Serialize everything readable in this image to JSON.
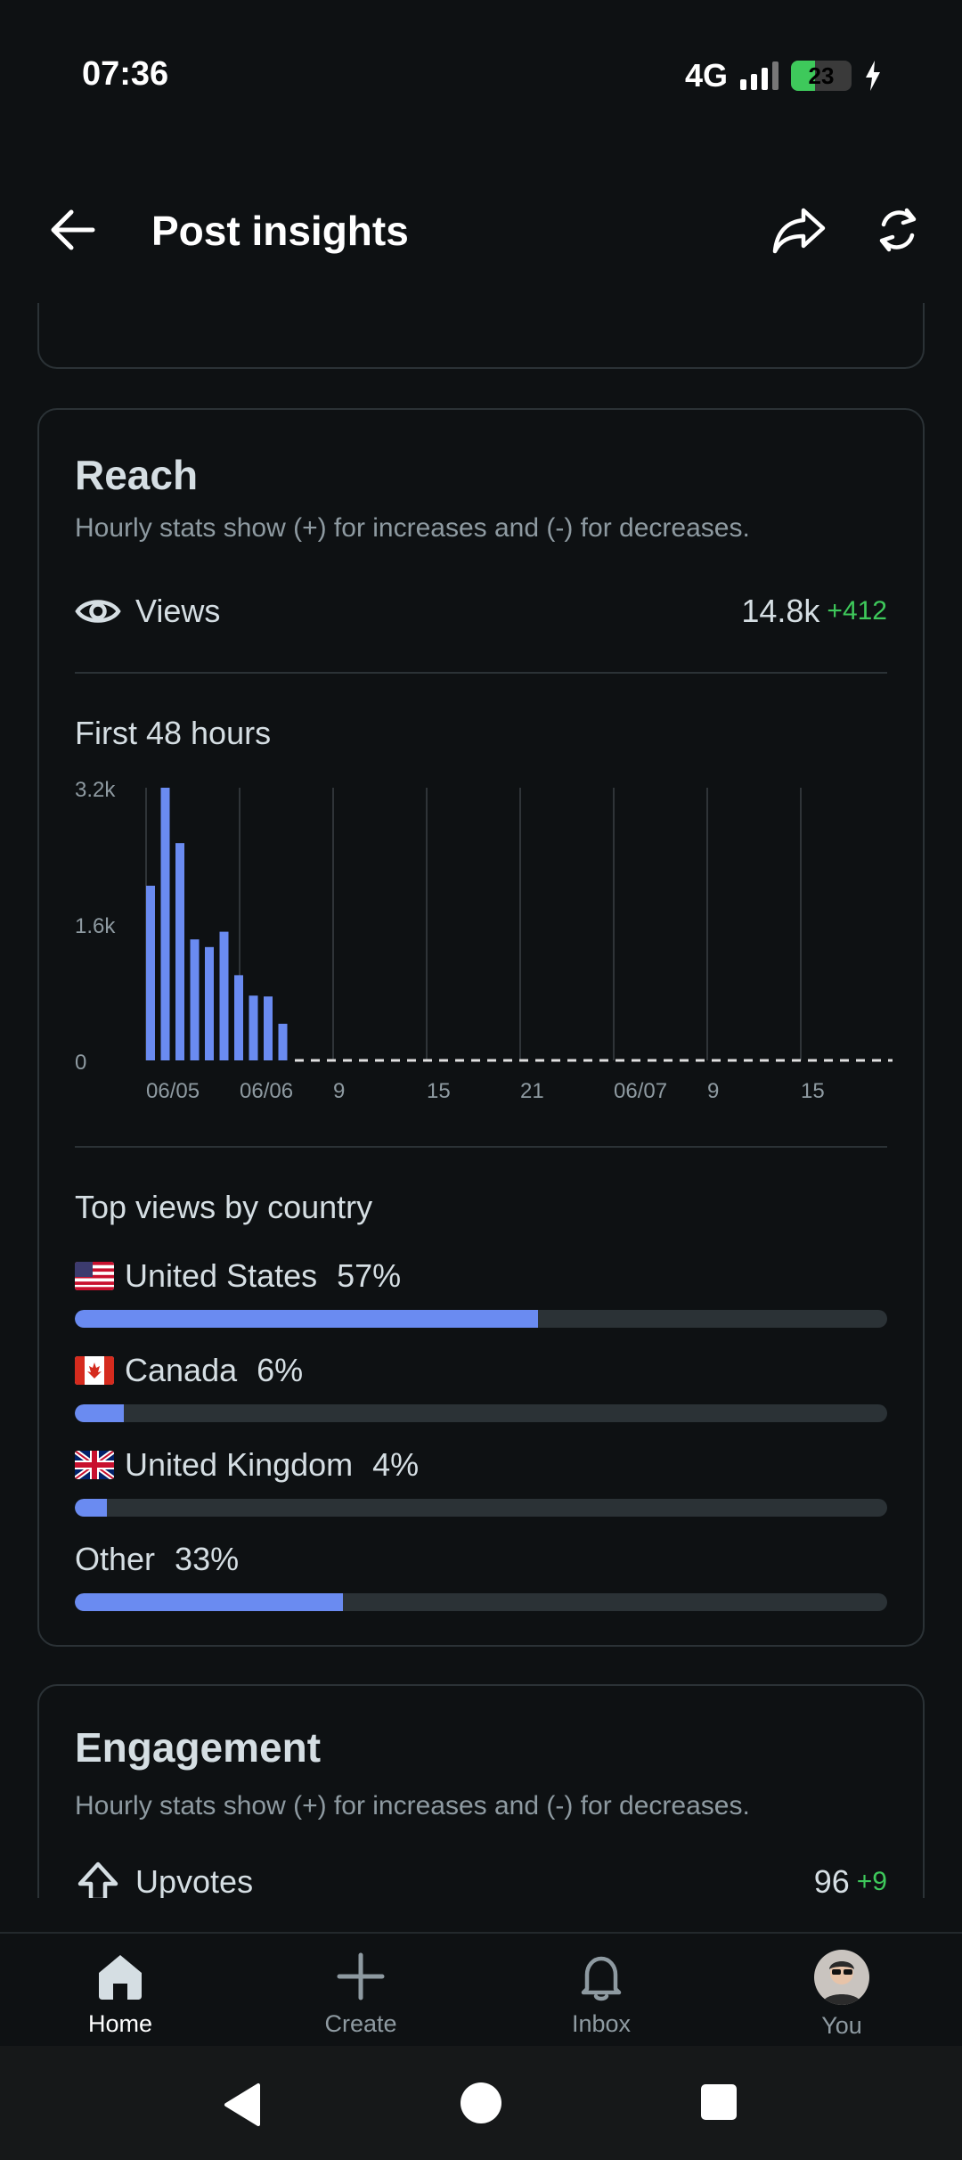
{
  "status_bar": {
    "time": "07:36",
    "network": "4G",
    "battery": "23"
  },
  "header": {
    "title": "Post insights",
    "icons": [
      "arrow-left-icon",
      "share-icon",
      "refresh-icon"
    ]
  },
  "reach": {
    "title": "Reach",
    "subtitle": "Hourly stats show (+) for increases and (-) for decreases.",
    "views_label": "Views",
    "views_value": "14.8k",
    "views_delta": "+412",
    "chart_title": "First 48 hours",
    "top_countries_title": "Top views by country",
    "countries": [
      {
        "name": "United States",
        "pct_label": "57%",
        "pct": 57,
        "flag": "us"
      },
      {
        "name": "Canada",
        "pct_label": "6%",
        "pct": 6,
        "flag": "ca"
      },
      {
        "name": "United Kingdom",
        "pct_label": "4%",
        "pct": 4,
        "flag": "gb"
      },
      {
        "name": "Other",
        "pct_label": "33%",
        "pct": 33,
        "flag": ""
      }
    ]
  },
  "chart_data": {
    "type": "bar",
    "title": "First 48 hours",
    "xlabel": "",
    "ylabel": "",
    "yticks": [
      "0",
      "1.6k",
      "3.2k"
    ],
    "ylim": [
      0,
      3200
    ],
    "xticks": [
      "06/05",
      "06/06",
      "9",
      "15",
      "21",
      "06/07",
      "9",
      "15"
    ],
    "values": [
      2050,
      3200,
      2550,
      1420,
      1330,
      1510,
      1000,
      760,
      750,
      430
    ],
    "bar_color": "#6a8bf1",
    "grid": true
  },
  "engagement": {
    "title": "Engagement",
    "subtitle": "Hourly stats show (+) for increases and (-) for decreases.",
    "upvotes_label": "Upvotes",
    "upvotes_value": "96",
    "upvotes_delta": "+9"
  },
  "bottom_nav": {
    "items": [
      {
        "label": "Home",
        "icon": "home-icon"
      },
      {
        "label": "Create",
        "icon": "plus-icon"
      },
      {
        "label": "Inbox",
        "icon": "bell-icon"
      },
      {
        "label": "You",
        "icon": "avatar"
      }
    ]
  },
  "colors": {
    "accent": "#6a8bf1",
    "positive": "#3ec95b",
    "background": "#0e1113"
  }
}
